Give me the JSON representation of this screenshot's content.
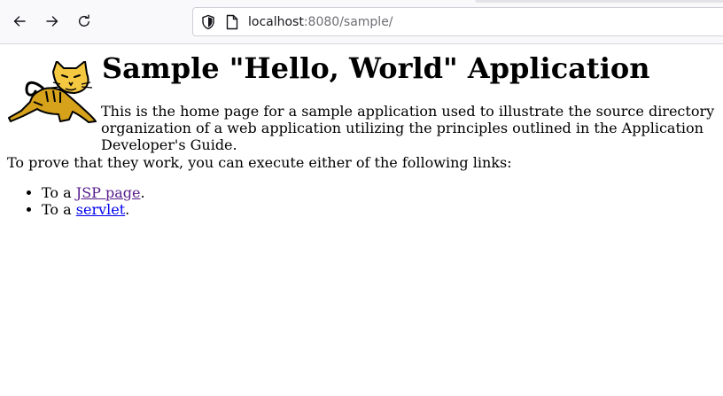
{
  "browser": {
    "url_host": "localhost",
    "url_rest": ":8080/sample/",
    "icons": {
      "back": "arrow-left-icon",
      "forward": "arrow-right-icon",
      "reload": "reload-icon",
      "tracking": "shield-icon",
      "page": "page-icon"
    }
  },
  "page": {
    "title": "Sample \"Hello, World\" Application",
    "intro_text": "This is the home page for a sample application used to illustrate the source directory organization of a web application utilizing the principles outlined in the Application Developer's Guide.",
    "prove_text": "To prove that they work, you can execute either of the following links:",
    "links": [
      {
        "prefix": "To a ",
        "label": "JSP page",
        "suffix": ".",
        "visited": true
      },
      {
        "prefix": "To a ",
        "label": "servlet",
        "suffix": ".",
        "visited": false
      }
    ],
    "colors": {
      "visited_link": "#551a8b",
      "unvisited_link": "#0000ee",
      "logo_fill": "#d6a21c"
    }
  }
}
